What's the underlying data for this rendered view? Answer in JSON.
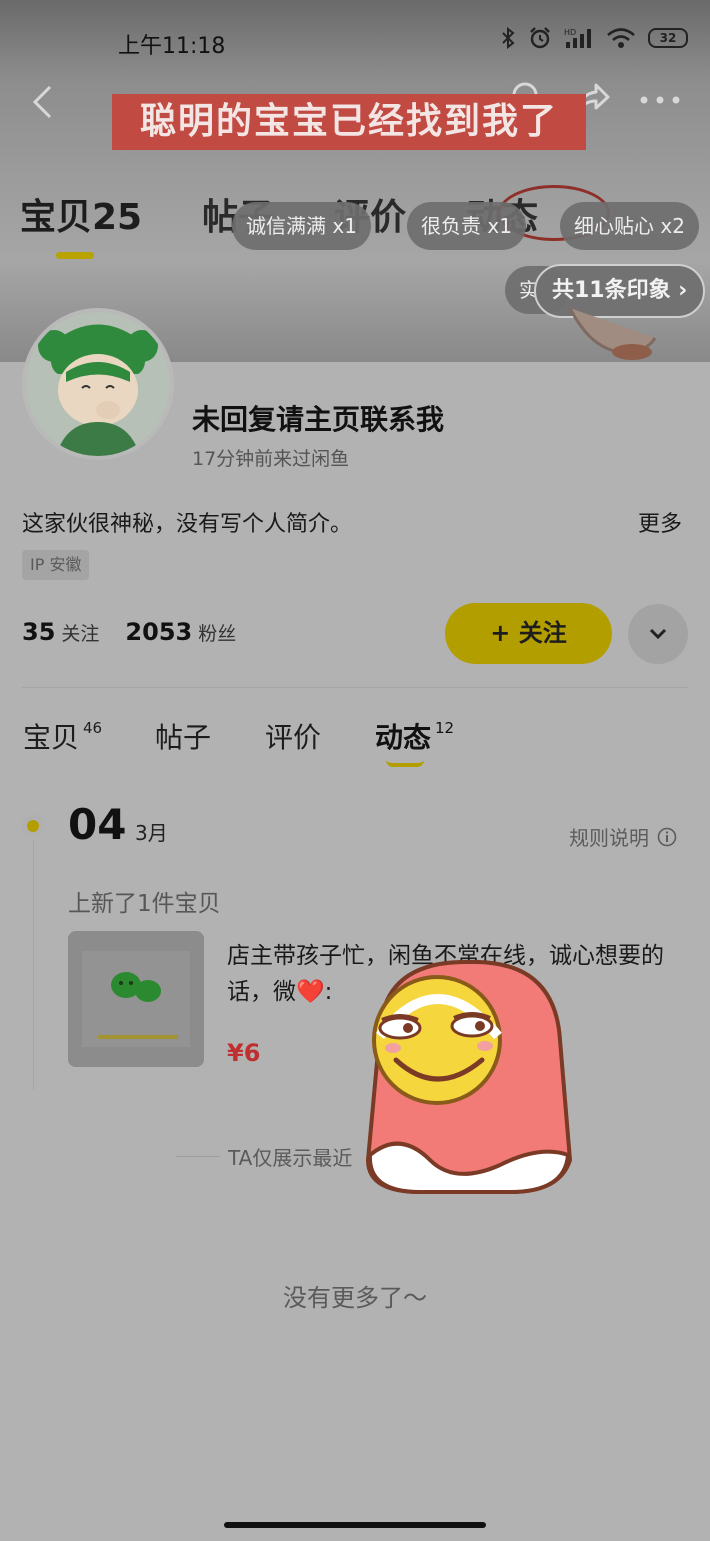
{
  "status_bar": {
    "time": "上午11:18",
    "battery": "32",
    "network_label": "HD"
  },
  "banner": {
    "ad_title": "聪明的宝宝已经找到我了",
    "ghost_tabs": [
      "宝贝25",
      "帖子",
      "评价",
      "动态"
    ],
    "impression_chips": [
      "诚信满满 x1",
      "很负责 x1",
      "细心贴心 x2"
    ],
    "impression_partial": "实",
    "impression_total": "共11条印象 ›"
  },
  "profile": {
    "nickname": "未回复请主页联系我",
    "last_seen": "17分钟前来过闲鱼",
    "bio": "这家伙很神秘，没有写个人简介。",
    "more": "更多",
    "ip": "IP 安徽",
    "following_count": "35",
    "following_label": "关注",
    "fans_count": "2053",
    "fans_label": "粉丝",
    "follow_button": "+ 关注"
  },
  "tabs": [
    {
      "label": "宝贝",
      "count": "46"
    },
    {
      "label": "帖子",
      "count": ""
    },
    {
      "label": "评价",
      "count": ""
    },
    {
      "label": "动态",
      "count": "12"
    }
  ],
  "feed": {
    "day": "04",
    "month": "3月",
    "rules": "规则说明",
    "event_label": "上新了1件宝贝",
    "item": {
      "description": "店主带孩子忙，闲鱼不常在线，诚心想要的话，微❤️:",
      "price": "¥6"
    },
    "hint_visible": "TA仅展示最近",
    "end_text": "没有更多了～"
  },
  "colors": {
    "accent": "#b39e00",
    "price": "#c02f2f",
    "overlay_background": "#b2b2b2"
  },
  "icons": [
    "back-icon",
    "search-icon",
    "share-icon",
    "more-icon",
    "chevron-down-icon",
    "info-icon",
    "bluetooth-icon",
    "alarm-icon",
    "signal-icon",
    "wifi-icon"
  ]
}
